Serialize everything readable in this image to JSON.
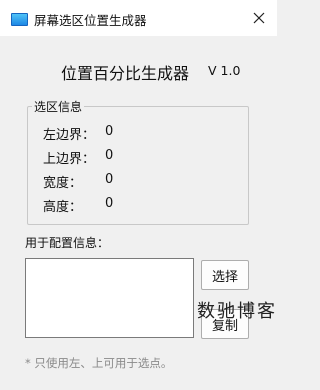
{
  "window": {
    "title": "屏幕选区位置生成器"
  },
  "header": {
    "title": "位置百分比生成器",
    "version": "V 1.0"
  },
  "selection": {
    "group_label": "选区信息",
    "fields": [
      {
        "label": "左边界：",
        "value": "0"
      },
      {
        "label": "上边界：",
        "value": "0"
      },
      {
        "label": "宽度：",
        "value": "0"
      },
      {
        "label": "高度：",
        "value": "0"
      }
    ]
  },
  "config": {
    "label": "用于配置信息：",
    "value": ""
  },
  "buttons": {
    "select_label": "选择",
    "copy_label": "复制"
  },
  "footnote": "* 只使用左、上可用于选点。",
  "watermark": "数驰博客",
  "icons": {
    "app": "app-window-icon",
    "close": "close-icon"
  }
}
